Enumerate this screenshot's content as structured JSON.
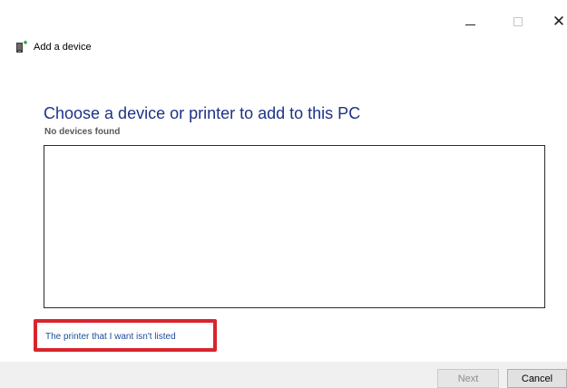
{
  "window": {
    "title": "Add a device",
    "caption_buttons": {
      "minimize_icon": "minimize-icon",
      "maximize_icon": "maximize-icon",
      "close_icon": "close-icon",
      "close_glyph": "✕"
    }
  },
  "main": {
    "heading": "Choose a device or printer to add to this PC",
    "status": "No devices found",
    "device_list_items": [],
    "link": "The printer that I want isn't listed"
  },
  "footer": {
    "next_label": "Next",
    "cancel_label": "Cancel"
  },
  "colors": {
    "heading": "#1e3287",
    "link": "#1c4c9a",
    "highlight_box": "#d9242d",
    "footer_bg": "#f0f0f0"
  }
}
